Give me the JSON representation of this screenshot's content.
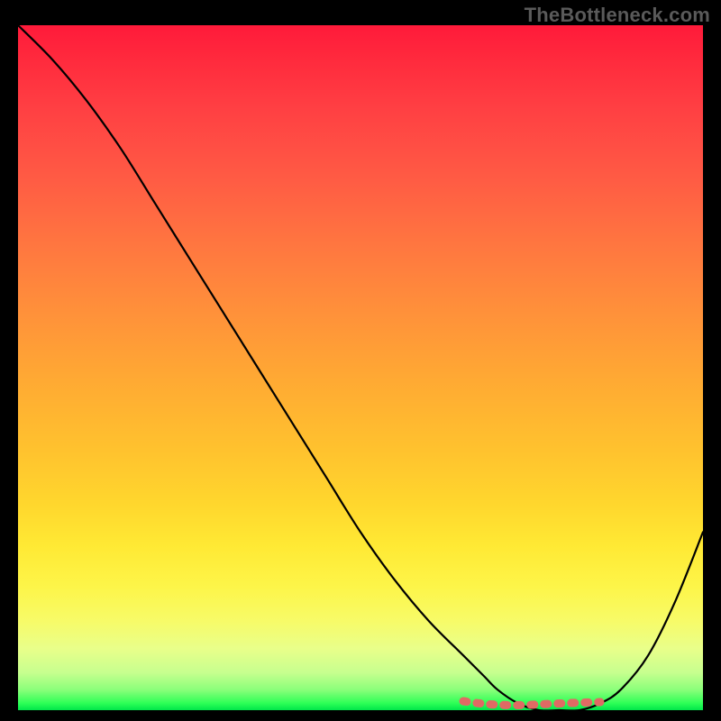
{
  "watermark": "TheBottleneck.com",
  "chart_data": {
    "type": "line",
    "title": "",
    "xlabel": "",
    "ylabel": "",
    "xlim": [
      0,
      100
    ],
    "ylim": [
      0,
      100
    ],
    "series": [
      {
        "name": "bottleneck-curve",
        "x": [
          0,
          5,
          10,
          15,
          20,
          25,
          30,
          35,
          40,
          45,
          50,
          55,
          60,
          65,
          68,
          70,
          73,
          76,
          79,
          82,
          85,
          88,
          92,
          96,
          100
        ],
        "values": [
          100,
          95,
          89,
          82,
          74,
          66,
          58,
          50,
          42,
          34,
          26,
          19,
          13,
          8,
          5,
          3,
          1,
          0,
          0,
          0,
          1,
          3,
          8,
          16,
          26
        ]
      }
    ],
    "plateau": {
      "name": "plateau-marker",
      "x_start": 65,
      "x_end": 85,
      "y": 0
    },
    "background_gradient": {
      "top": "#ff1a3a",
      "mid": "#ffe934",
      "bottom": "#00e54a"
    }
  }
}
